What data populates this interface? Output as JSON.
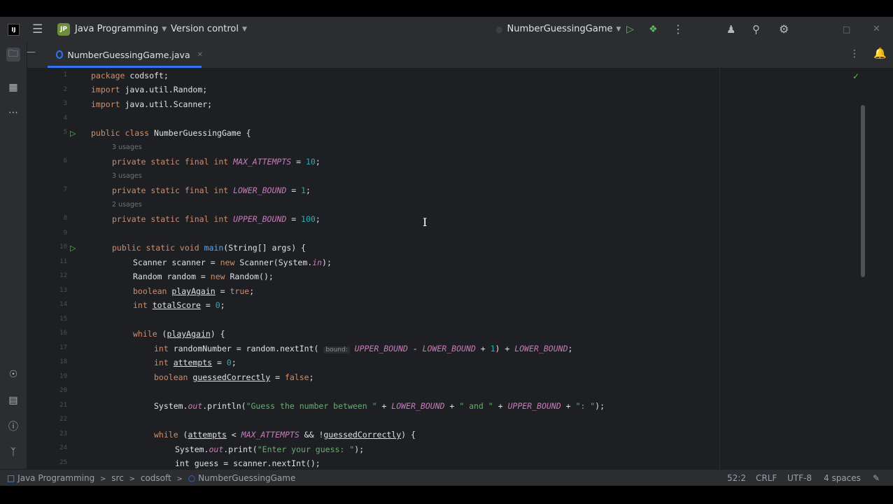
{
  "titlebar": {
    "logo": "IJ",
    "project_badge": "JP",
    "project_name": "Java Programming",
    "version_control": "Version control",
    "run_config": "NumberGuessingGame"
  },
  "tab": {
    "file_name": "NumberGuessingGame.java"
  },
  "colors": {
    "accent": "#3574f0",
    "run_green": "#5fb865",
    "keyword": "#cf8e6d",
    "field": "#c77dbb",
    "number": "#2aacb8",
    "string": "#6aab73"
  },
  "editor": {
    "line_numbers": [
      "1",
      "2",
      "3",
      "4",
      "5",
      "",
      "6",
      "",
      "7",
      "",
      "8",
      "9",
      "10",
      "11",
      "12",
      "13",
      "14",
      "15",
      "16",
      "17",
      "18",
      "19",
      "20",
      "21",
      "22",
      "23",
      "24",
      "25"
    ],
    "hints": [
      "3 usages",
      "3 usages",
      "2 usages"
    ],
    "param_hint": "bound:",
    "lines": {
      "l1a": "package",
      "l1b": " codsoft;",
      "l2a": "import",
      "l2b": " java.util.Random;",
      "l3a": "import",
      "l3b": " java.util.Scanner;",
      "l5a": "public class",
      "l5b": " NumberGuessingGame {",
      "l6a": "private static final int ",
      "l6b": "MAX_ATTEMPTS",
      "l6c": " = ",
      "l6d": "10",
      "l6e": ";",
      "l7a": "private static final int ",
      "l7b": "LOWER_BOUND",
      "l7c": " = ",
      "l7d": "1",
      "l7e": ";",
      "l8a": "private static final int ",
      "l8b": "UPPER_BOUND",
      "l8c": " = ",
      "l8d": "100",
      "l8e": ";",
      "l10a": "public static void ",
      "l10b": "main",
      "l10c": "(String[] args) {",
      "l11a": "Scanner scanner = ",
      "l11b": "new",
      "l11c": " Scanner(System.",
      "l11d": "in",
      "l11e": ");",
      "l12a": "Random random = ",
      "l12b": "new",
      "l12c": " Random();",
      "l13a": "boolean ",
      "l13b": "playAgain",
      "l13c": " = ",
      "l13d": "true",
      "l13e": ";",
      "l14a": "int ",
      "l14b": "totalScore",
      "l14c": " = ",
      "l14d": "0",
      "l14e": ";",
      "l16a": "while",
      "l16b": " (",
      "l16c": "playAgain",
      "l16d": ") {",
      "l17a": "int",
      "l17b": " randomNumber = random.nextInt( ",
      "l17c": "UPPER_BOUND",
      "l17d": " - ",
      "l17e": "LOWER_BOUND",
      "l17f": " + ",
      "l17g": "1",
      "l17h": ") + ",
      "l17i": "LOWER_BOUND",
      "l17j": ";",
      "l18a": "int ",
      "l18b": "attempts",
      "l18c": " = ",
      "l18d": "0",
      "l18e": ";",
      "l19a": "boolean ",
      "l19b": "guessedCorrectly",
      "l19c": " = ",
      "l19d": "false",
      "l19e": ";",
      "l21a": "System.",
      "l21b": "out",
      "l21c": ".println(",
      "l21d": "\"Guess the number between \"",
      "l21e": " + ",
      "l21f": "LOWER_BOUND",
      "l21g": " + ",
      "l21h": "\" and \"",
      "l21i": " + ",
      "l21j": "UPPER_BOUND",
      "l21k": " + ",
      "l21l": "\": \"",
      "l21m": ");",
      "l23a": "while",
      "l23b": " (",
      "l23c": "attempts",
      "l23d": " < ",
      "l23e": "MAX_ATTEMPTS",
      "l23f": " && !",
      "l23g": "guessedCorrectly",
      "l23h": ") {",
      "l24a": "System.",
      "l24b": "out",
      "l24c": ".print(",
      "l24d": "\"Enter your guess: \"",
      "l24e": ");",
      "l25a": "int guess = scanner.nextInt();"
    }
  },
  "statusbar": {
    "crumbs": [
      "Java Programming",
      "src",
      "codsoft",
      "NumberGuessingGame"
    ],
    "separator": ">",
    "position": "52:2",
    "line_ending": "CRLF",
    "encoding": "UTF-8",
    "indent": "4 spaces"
  }
}
